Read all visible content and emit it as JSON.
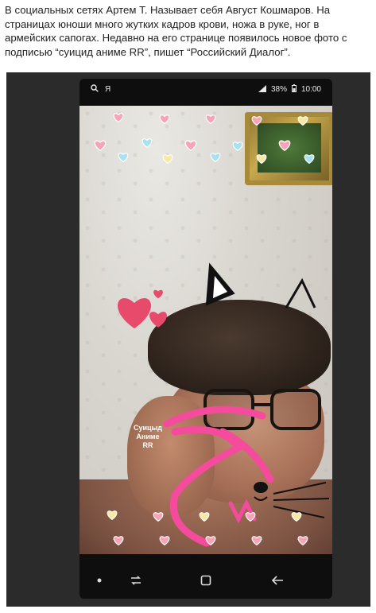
{
  "caption": "В социальных сетях Артем Т. Называет себя Август Кошмаров. На страницах юноши много жутких кадров крови, ножа в руке, ног в армейских сапогах. Недавно на его странице появилось новое фото с подписью “суицид аниме RR”, пишет “Российский Диалог”.",
  "status_bar": {
    "search_icon": "search-icon",
    "search_label": "Я",
    "battery_percent": "38%",
    "time": "10:00"
  },
  "photo": {
    "overlay_text_line1": "Суицыд",
    "overlay_text_line2": "Аниме",
    "overlay_text_line3": "RR"
  },
  "nav_bar": {
    "items": [
      "dot-icon",
      "recent-apps-icon",
      "home-icon",
      "back-icon"
    ]
  },
  "colors": {
    "heart_pink": "#f7a3b8",
    "heart_red": "#e84a6b",
    "scribble_pink": "#f44b9c"
  }
}
